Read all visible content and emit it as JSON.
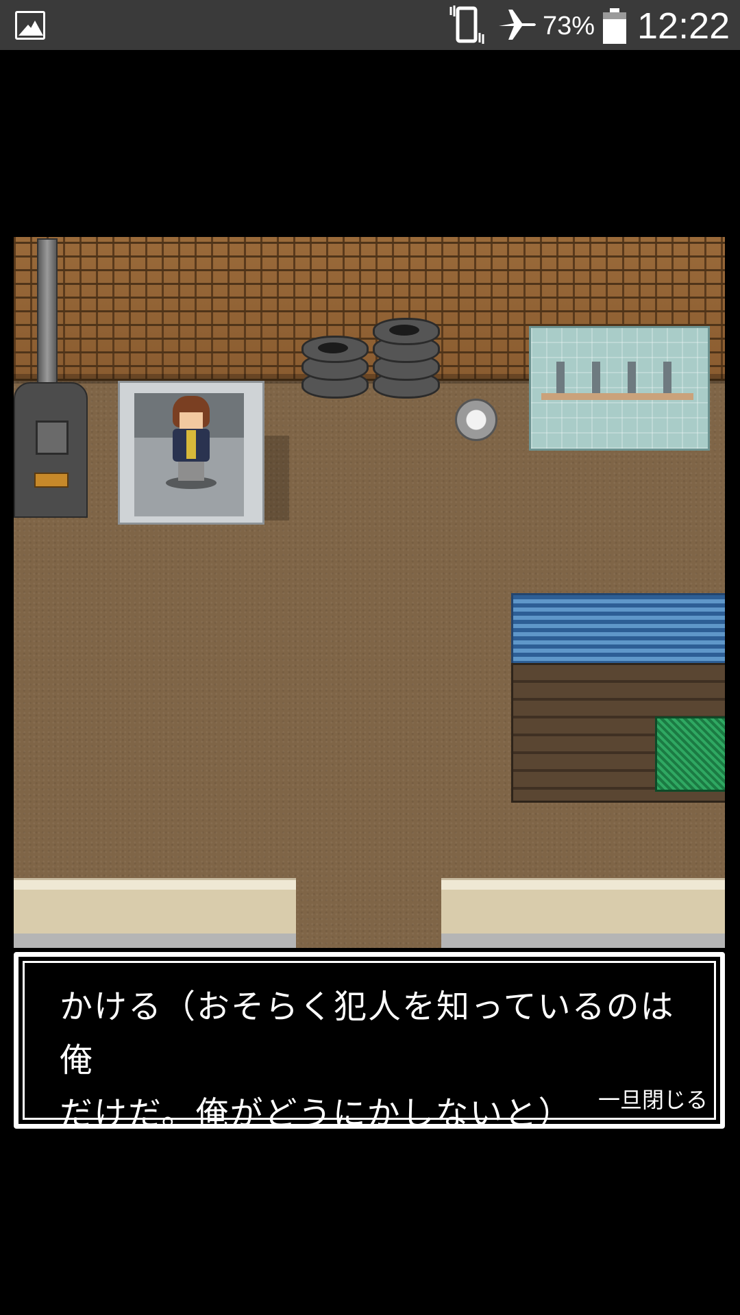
{
  "status_bar": {
    "battery_percent": "73%",
    "time": "12:22",
    "icons": [
      "gallery-icon",
      "vibrate-icon",
      "airplane-mode-icon",
      "battery-icon"
    ]
  },
  "dialog": {
    "line1": "かける（おそらく犯人を知っているのは俺",
    "line2": "だけだ。俺がどうにかしないと）",
    "close_label": "一旦閉じる"
  },
  "colors": {
    "floor": "#7f6547",
    "brick": "#8a5c30",
    "dialog_bg": "#000000",
    "dialog_border": "#ffffff",
    "status_bar_bg": "#3a3a3a"
  }
}
